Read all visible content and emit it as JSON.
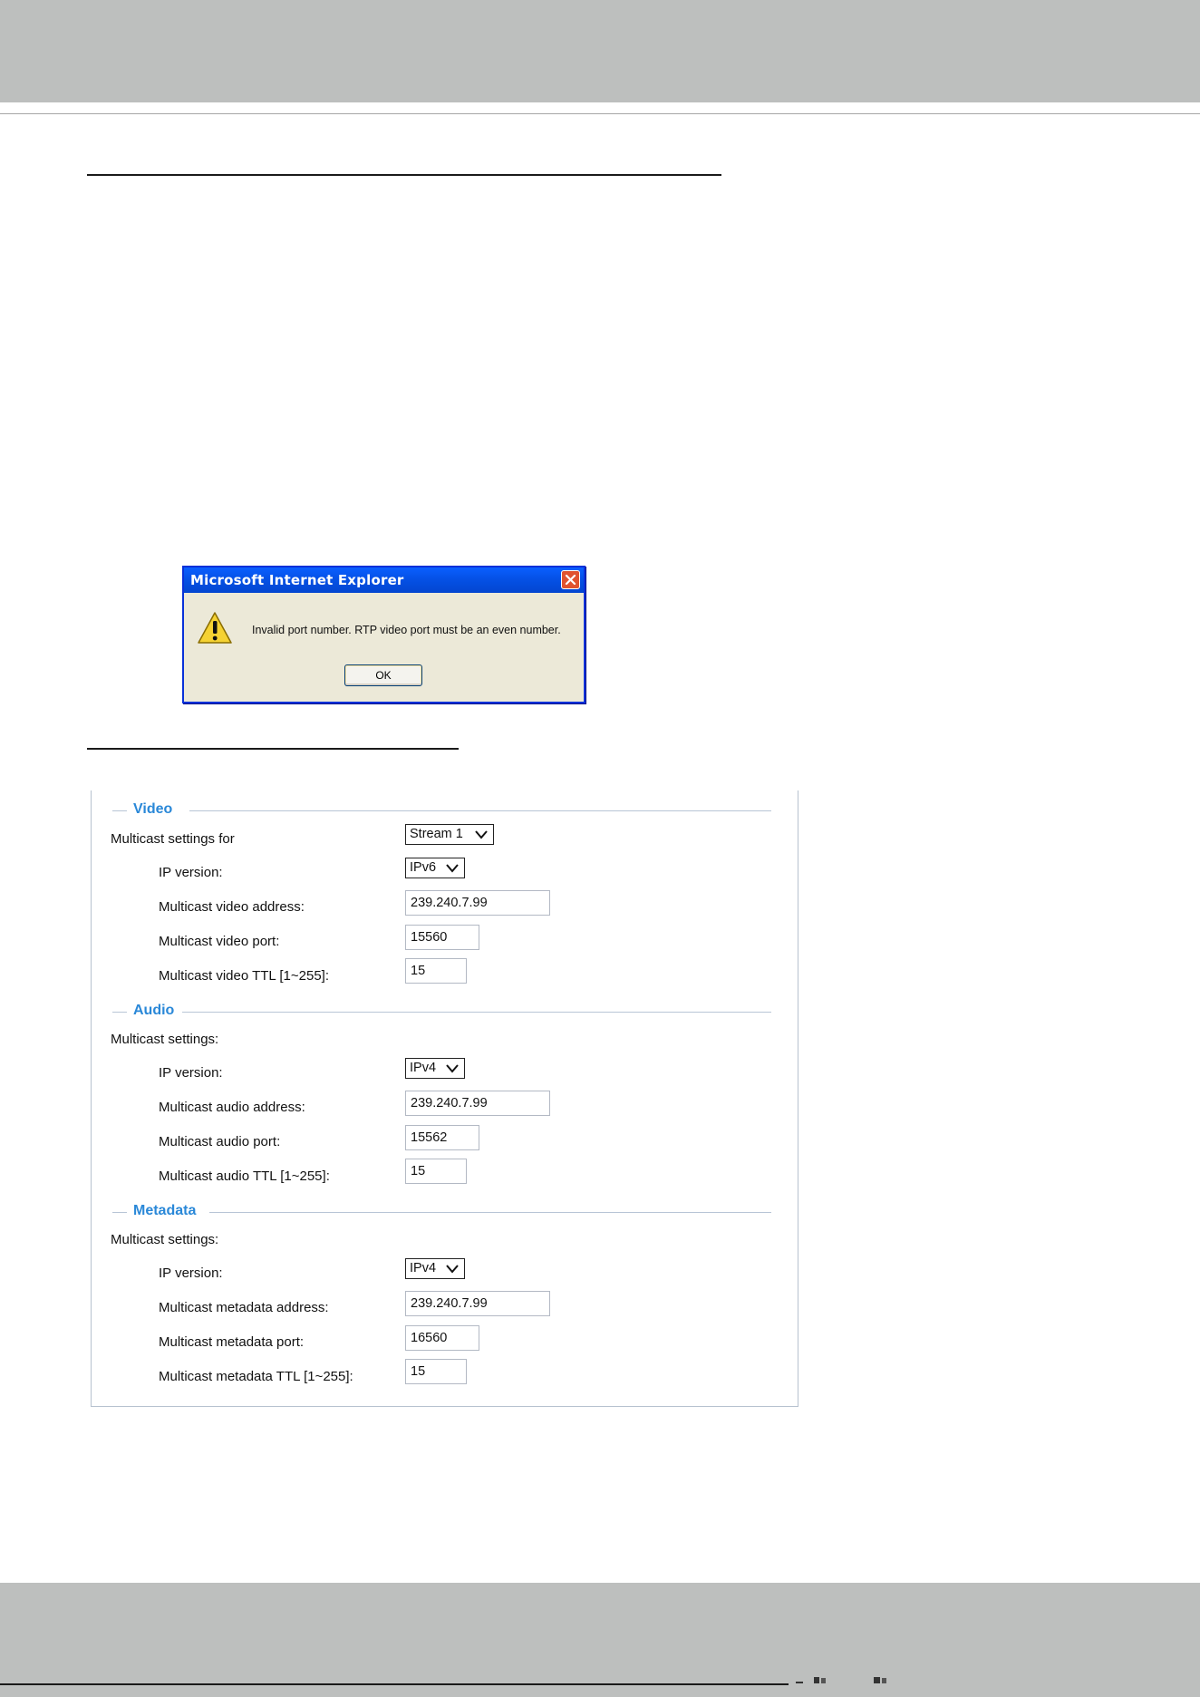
{
  "dialog": {
    "title": "Microsoft Internet Explorer",
    "message": "Invalid port number. RTP video port must be an even number.",
    "ok_label": "OK",
    "icons": {
      "close": "close-icon",
      "warning": "warning-icon"
    }
  },
  "video": {
    "title": "Video",
    "settings_label": "Multicast settings for",
    "stream_select": "Stream 1",
    "ip_version_label": "IP version:",
    "ip_version": "IPv6",
    "address_label": "Multicast video address:",
    "address": "239.240.7.99",
    "port_label": "Multicast video port:",
    "port": "15560",
    "ttl_label": "Multicast video TTL [1~255]:",
    "ttl": "15"
  },
  "audio": {
    "title": "Audio",
    "settings_label": "Multicast settings:",
    "ip_version_label": "IP version:",
    "ip_version": "IPv4",
    "address_label": "Multicast audio address:",
    "address": "239.240.7.99",
    "port_label": "Multicast audio port:",
    "port": "15562",
    "ttl_label": "Multicast audio TTL [1~255]:",
    "ttl": "15"
  },
  "metadata": {
    "title": "Metadata",
    "settings_label": "Multicast settings:",
    "ip_version_label": "IP version:",
    "ip_version": "IPv4",
    "address_label": "Multicast metadata address:",
    "address": "239.240.7.99",
    "port_label": "Multicast metadata port:",
    "port": "16560",
    "ttl_label": "Multicast metadata TTL [1~255]:",
    "ttl": "15"
  },
  "colors": {
    "section_title": "#2a88d8",
    "page_band": "#bdbfbe",
    "dialog_title_bar": "#0551e6",
    "dialog_body": "#ece9d8"
  }
}
